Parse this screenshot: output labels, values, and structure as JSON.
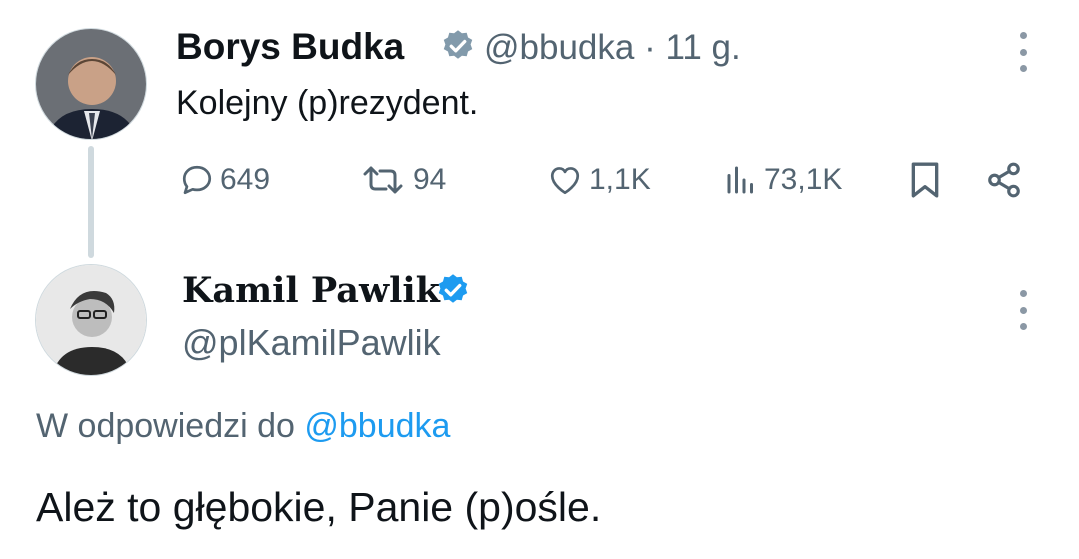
{
  "tweet": {
    "author": "Borys Budka",
    "handle": "@bbudka",
    "time": "· 11 g.",
    "text": "Kolejny (p)rezydent.",
    "actions": {
      "replies": "649",
      "retweets": "94",
      "likes": "1,1K",
      "views": "73,1K"
    }
  },
  "reply": {
    "author": "Kamil Pawlik",
    "handle": "@plKamilPawlik",
    "reply_prefix": "W odpowiedzi do",
    "reply_to": "@bbudka",
    "text": "Ależ to głębokie, Panie (p)ośle."
  },
  "colors": {
    "verified": "#1d9bf0",
    "verified_grey": "#829aab",
    "muted": "#536471",
    "link": "#1d9bf0"
  },
  "icons": [
    "reply-icon",
    "retweet-icon",
    "like-icon",
    "views-icon",
    "bookmark-icon",
    "share-icon",
    "more-icon",
    "verified-badge-icon"
  ]
}
